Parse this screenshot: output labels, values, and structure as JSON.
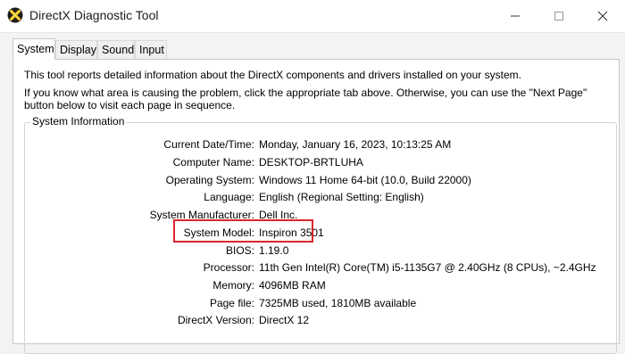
{
  "window": {
    "title": "DirectX Diagnostic Tool",
    "controls": {
      "minimize": "minimize",
      "maximize": "maximize",
      "close": "close"
    }
  },
  "tabs": [
    {
      "label": "System",
      "active": true
    },
    {
      "label": "Display",
      "active": false
    },
    {
      "label": "Sound",
      "active": false
    },
    {
      "label": "Input",
      "active": false
    }
  ],
  "intro": {
    "line1": "This tool reports detailed information about the DirectX components and drivers installed on your system.",
    "line2": "If you know what area is causing the problem, click the appropriate tab above.  Otherwise, you can use the \"Next Page\" button below to visit each page in sequence."
  },
  "system_info": {
    "title": "System Information",
    "rows": [
      {
        "label": "Current Date/Time:",
        "value": "Monday, January 16, 2023, 10:13:25 AM"
      },
      {
        "label": "Computer Name:",
        "value": "DESKTOP-BRTLUHA"
      },
      {
        "label": "Operating System:",
        "value": "Windows 11 Home 64-bit (10.0, Build 22000)"
      },
      {
        "label": "Language:",
        "value": "English (Regional Setting: English)"
      },
      {
        "label": "System Manufacturer:",
        "value": "Dell Inc."
      },
      {
        "label": "System Model:",
        "value": "Inspiron 3501"
      },
      {
        "label": "BIOS:",
        "value": "1.19.0"
      },
      {
        "label": "Processor:",
        "value": "11th Gen Intel(R) Core(TM) i5-1135G7 @ 2.40GHz (8 CPUs), ~2.4GHz"
      },
      {
        "label": "Memory:",
        "value": "4096MB RAM"
      },
      {
        "label": "Page file:",
        "value": "7325MB used, 1810MB available"
      },
      {
        "label": "DirectX Version:",
        "value": "DirectX 12"
      }
    ]
  },
  "colors": {
    "highlight": "#d9262b",
    "app_icon_bg": "#1d1d1d",
    "app_icon_mark": "#f4c20d"
  },
  "icons": [
    "directx-app-icon",
    "minimize-icon",
    "maximize-icon",
    "close-icon"
  ]
}
